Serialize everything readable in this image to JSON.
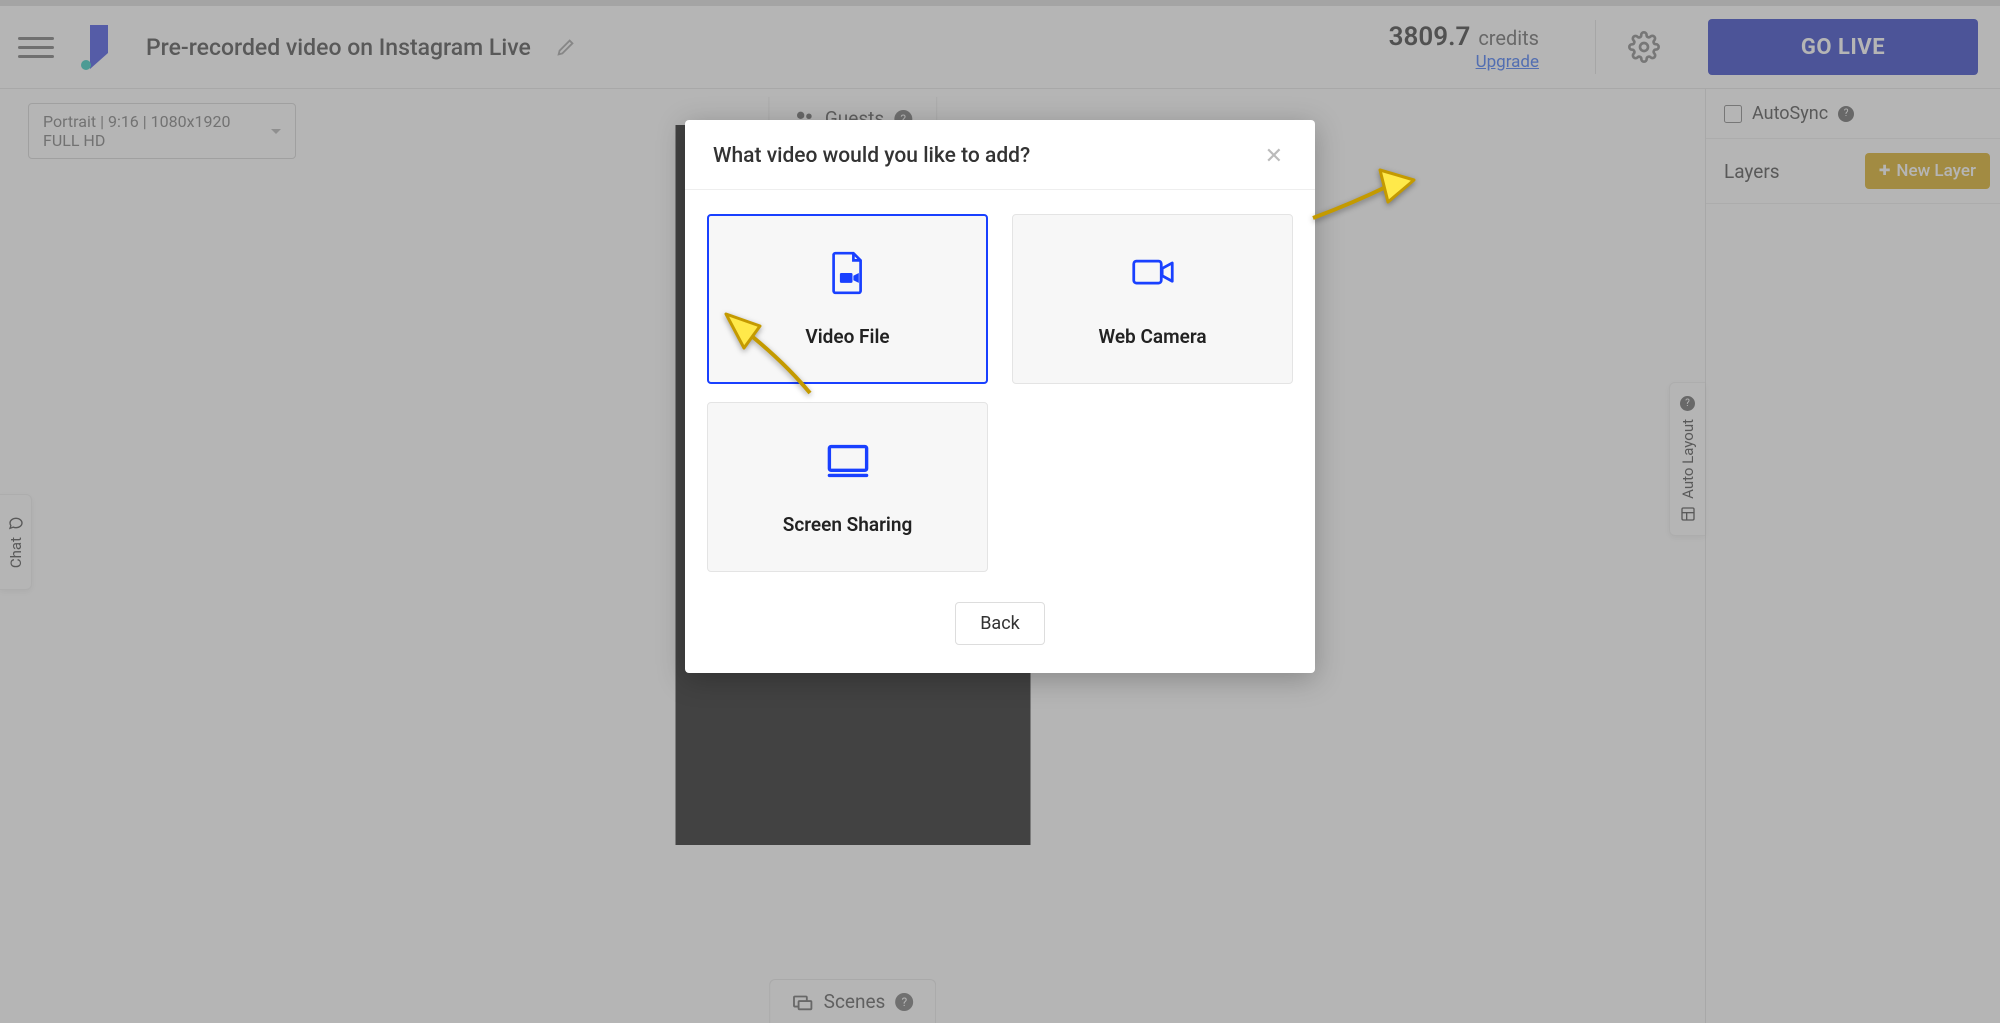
{
  "header": {
    "title": "Pre-recorded video on Instagram Live",
    "credits_value": "3809.7",
    "credits_label": "credits",
    "upgrade_label": "Upgrade",
    "go_live_label": "GO LIVE"
  },
  "main": {
    "format_label": "Portrait | 9:16 | 1080x1920 FULL HD",
    "guests_label": "Guests",
    "scenes_label": "Scenes",
    "chat_label": "Chat",
    "autolayout_label": "Auto Layout"
  },
  "side": {
    "autosync_label": "AutoSync",
    "layers_label": "Layers",
    "new_layer_label": "New Layer"
  },
  "modal": {
    "title": "What video would you like to add?",
    "options": {
      "video_file": "Video File",
      "web_camera": "Web Camera",
      "screen_sharing": "Screen Sharing"
    },
    "back_label": "Back"
  }
}
